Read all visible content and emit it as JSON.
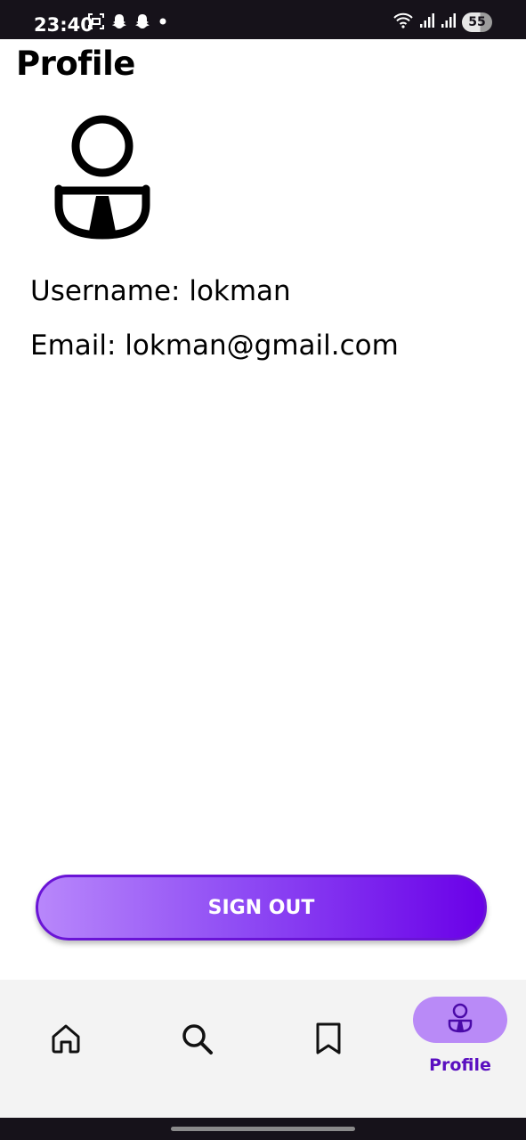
{
  "status_bar": {
    "time": "23:40",
    "left_icons": [
      "screenshot-icon",
      "snapchat-icon",
      "snapchat-icon",
      "dot-icon"
    ],
    "right_icons": [
      "wifi-icon",
      "signal-icon",
      "signal-icon"
    ],
    "battery": "55"
  },
  "header": {
    "title": "Profile"
  },
  "profile": {
    "avatar_icon": "person-icon",
    "username_text": "Username: lokman",
    "email_text": "Email: lokman@gmail.com"
  },
  "actions": {
    "sign_out_label": "SIGN OUT"
  },
  "colors": {
    "accent": "#6a00e8",
    "accent_light": "#b887fb",
    "active_pill": "#b98af7",
    "active_label": "#5a0fc0"
  },
  "bottom_nav": {
    "items": [
      {
        "icon": "home-icon",
        "label": ""
      },
      {
        "icon": "search-icon",
        "label": ""
      },
      {
        "icon": "bookmark-icon",
        "label": ""
      },
      {
        "icon": "profile-icon",
        "label": "Profile",
        "active": true
      }
    ]
  }
}
